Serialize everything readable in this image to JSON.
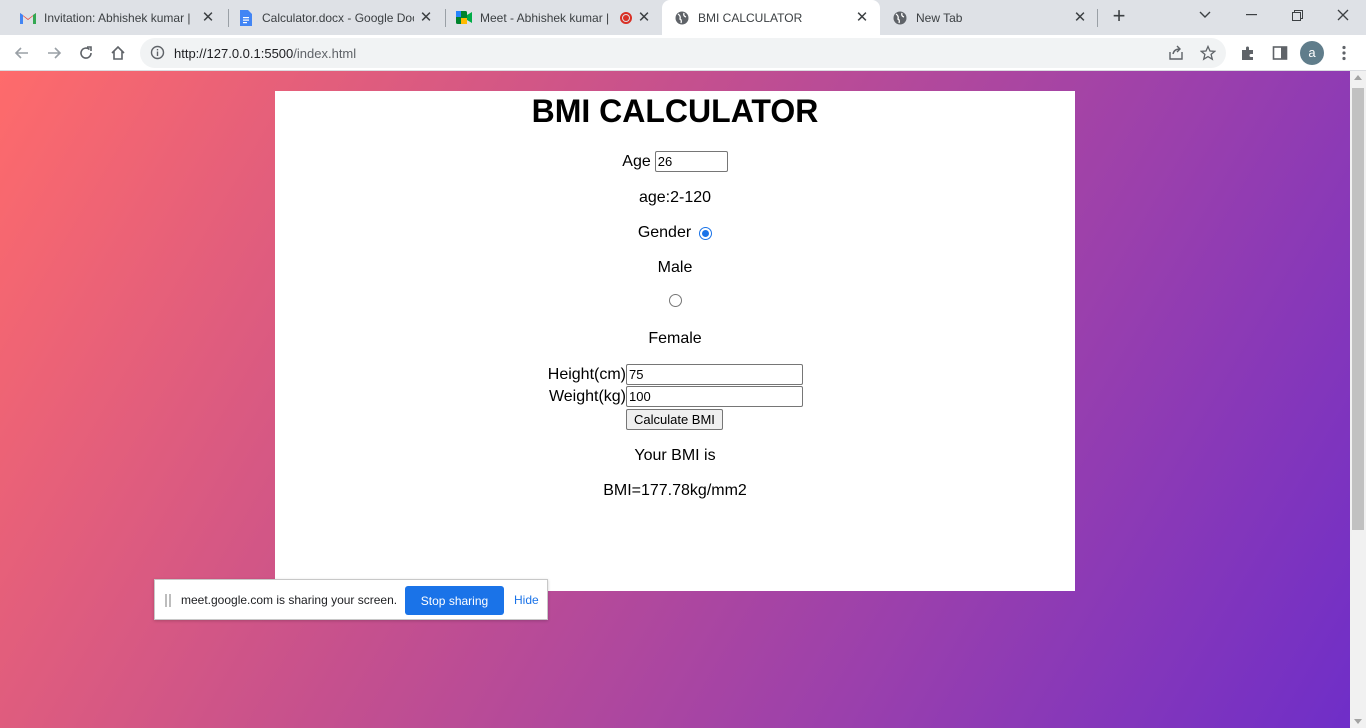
{
  "browser": {
    "tabs": [
      {
        "title": "Invitation: Abhishek kumar |",
        "icon": "gmail-icon"
      },
      {
        "title": "Calculator.docx - Google Doc",
        "icon": "google-docs-icon"
      },
      {
        "title": "Meet - Abhishek kumar |",
        "icon": "google-meet-icon",
        "recording": true
      },
      {
        "title": "BMI CALCULATOR",
        "icon": "globe-icon",
        "active": true
      },
      {
        "title": "New Tab",
        "icon": "globe-icon"
      }
    ],
    "close_glyph": "✕",
    "new_tab_glyph": "+",
    "url_host": "http://127.0.0.1:5500",
    "url_path": "/index.html",
    "profile_initial": "a"
  },
  "page": {
    "title": "BMI CALCULATOR",
    "age_label": "Age",
    "age_value": "26",
    "age_hint": "age:2-120",
    "gender_label": "Gender",
    "male_label": "Male",
    "female_label": "Female",
    "male_checked": true,
    "height_label": "Height(cm)",
    "height_value": "75",
    "weight_label": "Weight(kg)",
    "weight_value": "100",
    "calculate_label": "Calculate BMI",
    "result_label": "Your BMI is",
    "result_value": "BMI=177.78kg/mm2"
  },
  "sharebar": {
    "message": "meet.google.com is sharing your screen.",
    "stop_label": "Stop sharing",
    "hide_label": "Hide"
  },
  "colors": {
    "accent": "#1a73e8",
    "gradient_start": "#fe6b6b",
    "gradient_end": "#6f2ec8"
  }
}
